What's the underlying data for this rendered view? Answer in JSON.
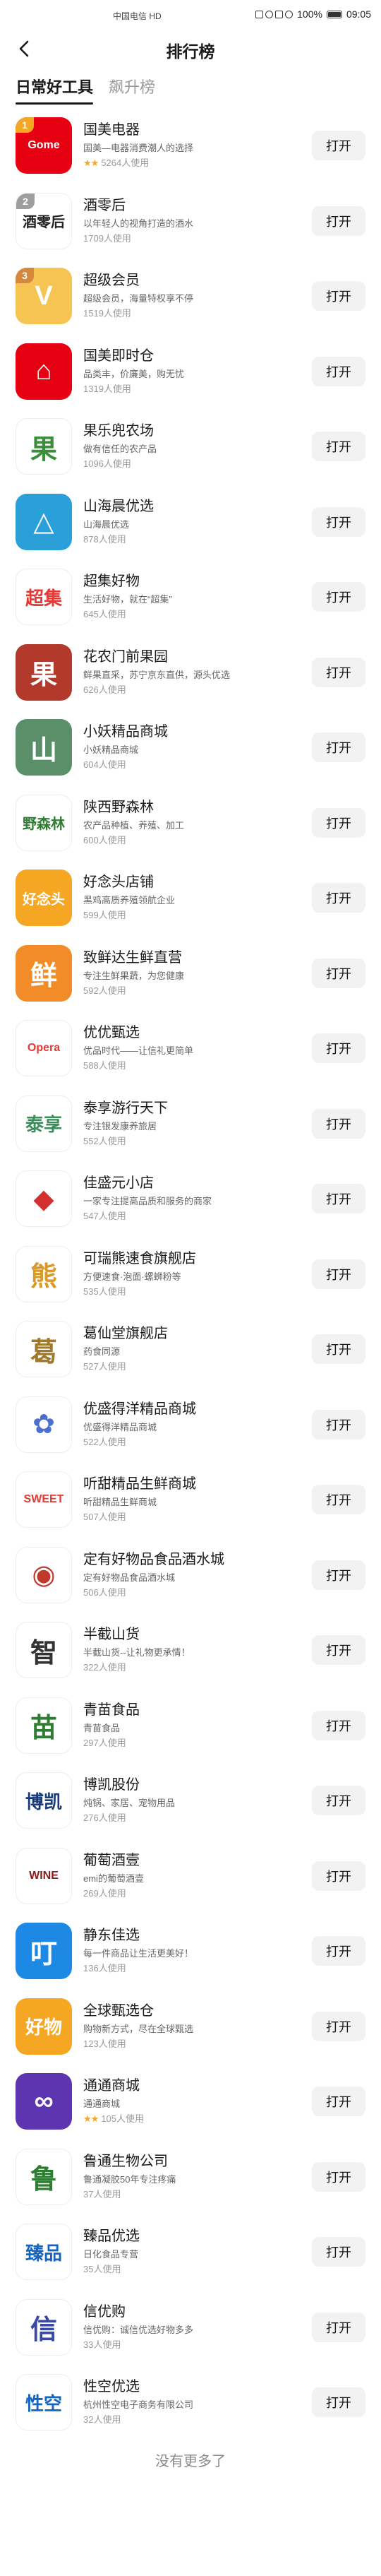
{
  "status_bar": {
    "carrier": "中国电信 HD",
    "battery": "100%",
    "time": "09:05"
  },
  "header": {
    "title": "排行榜",
    "back_icon": "chevron-left-icon"
  },
  "tabs": [
    {
      "label": "日常好工具",
      "active": true
    },
    {
      "label": "飙升榜",
      "active": false
    }
  ],
  "open_label": "打开",
  "footer": "没有更多了",
  "items": [
    {
      "name": "国美电器",
      "desc": "国美—电器消费潮人的选择",
      "usage": "5264人使用",
      "rating": "2",
      "rank": "1",
      "icon_text": "Gome",
      "icon_bg": "#e60012",
      "icon_fg": "#ffffff"
    },
    {
      "name": "酒零后",
      "desc": "以年轻人的视角打造的酒水",
      "usage": "1709人使用",
      "rating": "",
      "rank": "2",
      "icon_text": "酒零后",
      "icon_bg": "#ffffff",
      "icon_fg": "#222222"
    },
    {
      "name": "超级会员",
      "desc": "超级会员，海量特权享不停",
      "usage": "1519人使用",
      "rating": "",
      "rank": "3",
      "icon_text": "V",
      "icon_bg": "#f6c453",
      "icon_fg": "#ffffff"
    },
    {
      "name": "国美即时仓",
      "desc": "品类丰，价廉美，购无忧",
      "usage": "1319人使用",
      "rating": "",
      "rank": "",
      "icon_text": "⌂",
      "icon_bg": "#e60012",
      "icon_fg": "#ffffff"
    },
    {
      "name": "果乐兜农场",
      "desc": "做有信任的农产品",
      "usage": "1096人使用",
      "rating": "",
      "rank": "",
      "icon_text": "果",
      "icon_bg": "#ffffff",
      "icon_fg": "#3a8f3a"
    },
    {
      "name": "山海晨优选",
      "desc": "山海晨优选",
      "usage": "878人使用",
      "rating": "",
      "rank": "",
      "icon_text": "△",
      "icon_bg": "#2a9fd8",
      "icon_fg": "#ffffff"
    },
    {
      "name": "超集好物",
      "desc": "生活好物，就在“超集”",
      "usage": "645人使用",
      "rating": "",
      "rank": "",
      "icon_text": "超集",
      "icon_bg": "#ffffff",
      "icon_fg": "#e53935"
    },
    {
      "name": "花农门前果园",
      "desc": "鲜果直采，苏宁京东直供，源头优选",
      "usage": "626人使用",
      "rating": "",
      "rank": "",
      "icon_text": "果",
      "icon_bg": "#b23a2c",
      "icon_fg": "#ffffff"
    },
    {
      "name": "小妖精品商城",
      "desc": "小妖精品商城",
      "usage": "604人使用",
      "rating": "",
      "rank": "",
      "icon_text": "山",
      "icon_bg": "#5b8f6a",
      "icon_fg": "#ffffff"
    },
    {
      "name": "陕西野森林",
      "desc": "农产品种植、养殖、加工",
      "usage": "600人使用",
      "rating": "",
      "rank": "",
      "icon_text": "野森林",
      "icon_bg": "#ffffff",
      "icon_fg": "#2e7d32"
    },
    {
      "name": "好念头店铺",
      "desc": "黑鸡高质养殖领航企业",
      "usage": "599人使用",
      "rating": "",
      "rank": "",
      "icon_text": "好念头",
      "icon_bg": "#f5a623",
      "icon_fg": "#ffffff"
    },
    {
      "name": "致鲜达生鲜直营",
      "desc": "专注生鲜果蔬，为您健康",
      "usage": "592人使用",
      "rating": "",
      "rank": "",
      "icon_text": "鲜",
      "icon_bg": "#f28c28",
      "icon_fg": "#ffffff"
    },
    {
      "name": "优优甄选",
      "desc": "优品时代——让信礼更简单",
      "usage": "588人使用",
      "rating": "",
      "rank": "",
      "icon_text": "Opera",
      "icon_bg": "#ffffff",
      "icon_fg": "#e53935"
    },
    {
      "name": "泰享游行天下",
      "desc": "专注银发康养旅居",
      "usage": "552人使用",
      "rating": "",
      "rank": "",
      "icon_text": "泰享",
      "icon_bg": "#ffffff",
      "icon_fg": "#3d8c5c"
    },
    {
      "name": "佳盛元小店",
      "desc": "一家专注提高品质和服务的商家",
      "usage": "547人使用",
      "rating": "",
      "rank": "",
      "icon_text": "◆",
      "icon_bg": "#ffffff",
      "icon_fg": "#d32f2f"
    },
    {
      "name": "可瑞熊速食旗舰店",
      "desc": "方便速食·泡面·螺蛳粉等",
      "usage": "535人使用",
      "rating": "",
      "rank": "",
      "icon_text": "熊",
      "icon_bg": "#ffffff",
      "icon_fg": "#d89a2b"
    },
    {
      "name": "葛仙堂旗舰店",
      "desc": "药食同源",
      "usage": "527人使用",
      "rating": "",
      "rank": "",
      "icon_text": "葛",
      "icon_bg": "#ffffff",
      "icon_fg": "#a07a2c"
    },
    {
      "name": "优盛得洋精品商城",
      "desc": "优盛得洋精品商城",
      "usage": "522人使用",
      "rating": "",
      "rank": "",
      "icon_text": "✿",
      "icon_bg": "#ffffff",
      "icon_fg": "#4a6fd1"
    },
    {
      "name": "听甜精品生鲜商城",
      "desc": "听甜精品生鲜商城",
      "usage": "507人使用",
      "rating": "",
      "rank": "",
      "icon_text": "SWEET",
      "icon_bg": "#ffffff",
      "icon_fg": "#e53935"
    },
    {
      "name": "定有好物品食品酒水城",
      "desc": "定有好物品食品酒水城",
      "usage": "506人使用",
      "rating": "",
      "rank": "",
      "icon_text": "◉",
      "icon_bg": "#ffffff",
      "icon_fg": "#c0392b"
    },
    {
      "name": "半截山货",
      "desc": "半截山货--让礼物更承情！",
      "usage": "322人使用",
      "rating": "",
      "rank": "",
      "icon_text": "智",
      "icon_bg": "#ffffff",
      "icon_fg": "#333333"
    },
    {
      "name": "青苗食品",
      "desc": "青苗食品",
      "usage": "297人使用",
      "rating": "",
      "rank": "",
      "icon_text": "苗",
      "icon_bg": "#ffffff",
      "icon_fg": "#2e7d32"
    },
    {
      "name": "博凯股份",
      "desc": "炖锅、家居、宠物用品",
      "usage": "276人使用",
      "rating": "",
      "rank": "",
      "icon_text": "博凯",
      "icon_bg": "#ffffff",
      "icon_fg": "#1a3c7a"
    },
    {
      "name": "葡萄酒壹",
      "desc": "emi的葡萄酒壹",
      "usage": "269人使用",
      "rating": "",
      "rank": "",
      "icon_text": "WINE",
      "icon_bg": "#ffffff",
      "icon_fg": "#8b1a1a"
    },
    {
      "name": "静东佳选",
      "desc": "每一件商品让生活更美好！",
      "usage": "136人使用",
      "rating": "",
      "rank": "",
      "icon_text": "叮",
      "icon_bg": "#1e88e5",
      "icon_fg": "#ffffff"
    },
    {
      "name": "全球甄选仓",
      "desc": "购物新方式，尽在全球甄选",
      "usage": "123人使用",
      "rating": "",
      "rank": "",
      "icon_text": "好物",
      "icon_bg": "#f5a623",
      "icon_fg": "#ffffff"
    },
    {
      "name": "通通商城",
      "desc": "通通商城",
      "usage": "105人使用",
      "rating": "2",
      "rank": "",
      "icon_text": "∞",
      "icon_bg": "#5e35b1",
      "icon_fg": "#ffffff"
    },
    {
      "name": "鲁通生物公司",
      "desc": "鲁通凝胶50年专注疼痛",
      "usage": "37人使用",
      "rating": "",
      "rank": "",
      "icon_text": "鲁",
      "icon_bg": "#ffffff",
      "icon_fg": "#2e7d32"
    },
    {
      "name": "臻品优选",
      "desc": "日化食品专营",
      "usage": "35人使用",
      "rating": "",
      "rank": "",
      "icon_text": "臻品",
      "icon_bg": "#ffffff",
      "icon_fg": "#1565c0"
    },
    {
      "name": "信优购",
      "desc": "信优购：诚信优选好物多多",
      "usage": "33人使用",
      "rating": "",
      "rank": "",
      "icon_text": "信",
      "icon_bg": "#ffffff",
      "icon_fg": "#3949ab"
    },
    {
      "name": "性空优选",
      "desc": "杭州性空电子商务有限公司",
      "usage": "32人使用",
      "rating": "",
      "rank": "",
      "icon_text": "性空",
      "icon_bg": "#ffffff",
      "icon_fg": "#1565c0"
    }
  ]
}
